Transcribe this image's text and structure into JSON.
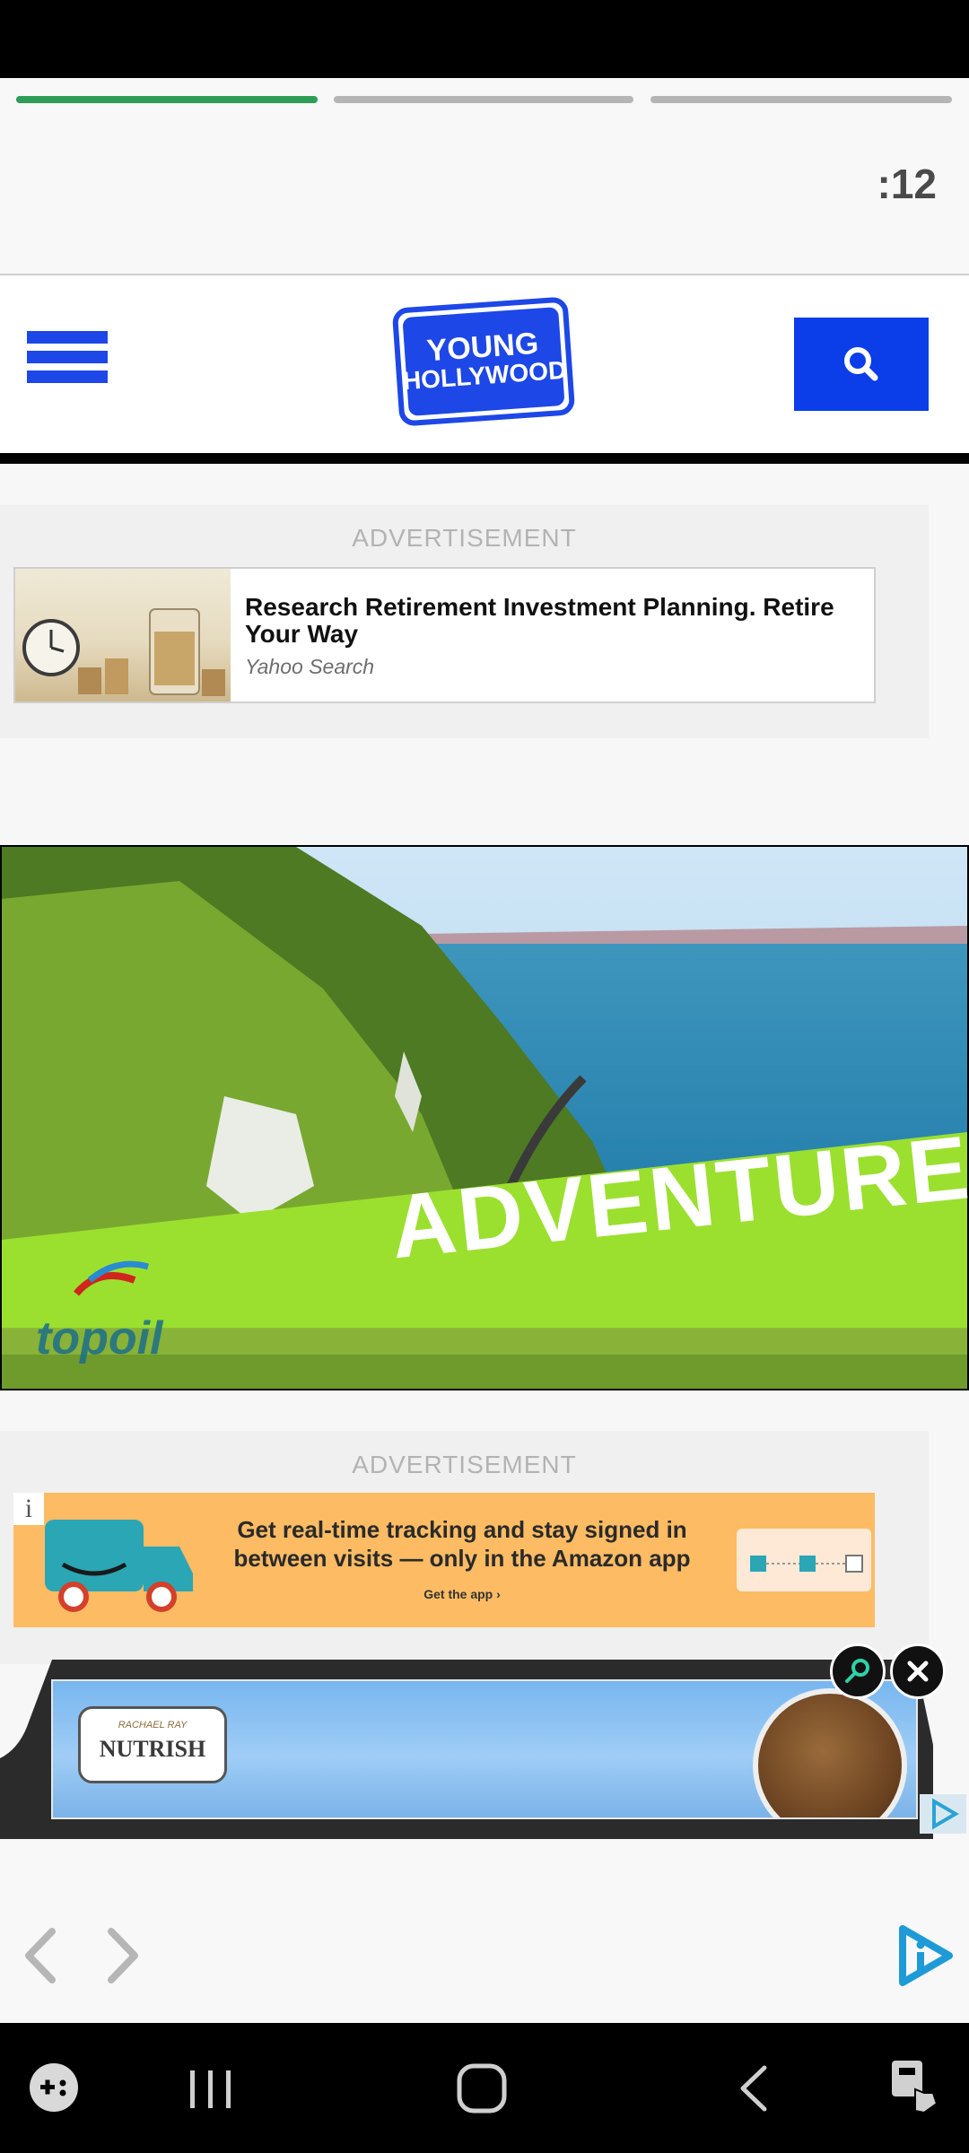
{
  "story": {
    "timer": ":12",
    "segments": [
      {
        "state": "active",
        "progress": 1.0
      },
      {
        "state": "pending",
        "progress": 0
      },
      {
        "state": "pending",
        "progress": 0
      }
    ]
  },
  "header": {
    "menu_icon": "hamburger-icon",
    "logo_line1": "YOUNG",
    "logo_line2": "HOLLYWOOD",
    "search_icon": "search-icon"
  },
  "ad1": {
    "label": "ADVERTISEMENT",
    "headline": "Research Retirement Investment Planning. Retire Your Way",
    "source": "Yahoo Search"
  },
  "video": {
    "caption": "ADVENTURE",
    "brand": "topoil"
  },
  "ad2": {
    "label": "ADVERTISEMENT",
    "info_glyph": "i",
    "text": "Get real-time tracking and stay signed in between visits — only in the Amazon app",
    "cta": "Get the app ›"
  },
  "float_ad": {
    "brand_top": "RACHAEL RAY",
    "brand": "NUTRISH"
  },
  "colors": {
    "brand_blue": "#1d47e6",
    "progress_green": "#2e9e57",
    "amazon_orange": "#fdbb63",
    "ad_lime": "#9be02e"
  }
}
